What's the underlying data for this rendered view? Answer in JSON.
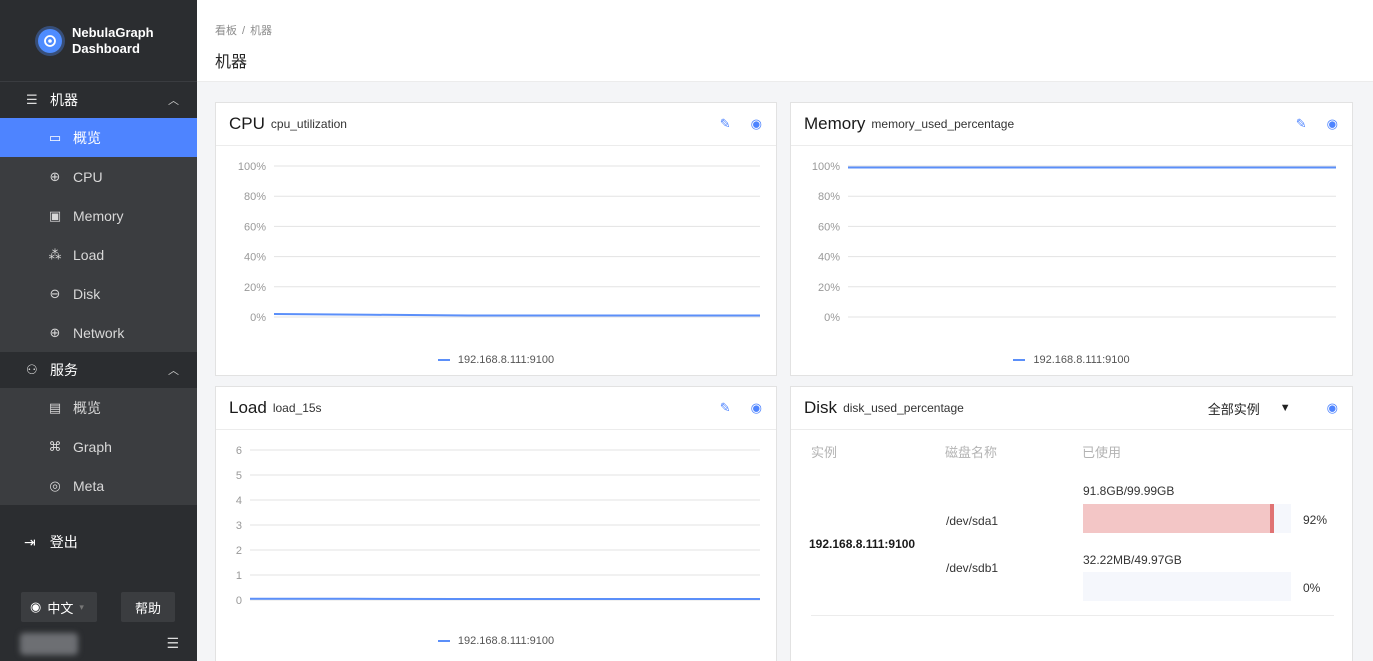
{
  "app": {
    "name_line1": "NebulaGraph",
    "name_line2": "Dashboard"
  },
  "sidebar": {
    "machine_group": "机器",
    "machine_items": [
      {
        "label": "概览",
        "icon": "area-chart-icon",
        "active": true
      },
      {
        "label": "CPU",
        "icon": "cpu-icon"
      },
      {
        "label": "Memory",
        "icon": "save-icon"
      },
      {
        "label": "Load",
        "icon": "network-nodes-icon"
      },
      {
        "label": "Disk",
        "icon": "hdd-icon"
      },
      {
        "label": "Network",
        "icon": "globe-icon"
      }
    ],
    "service_group": "服务",
    "service_items": [
      {
        "label": "概览",
        "icon": "chart-box-icon"
      },
      {
        "label": "Graph",
        "icon": "graph-icon"
      },
      {
        "label": "Meta",
        "icon": "target-icon"
      }
    ],
    "logout": "登出",
    "language": "中文",
    "help": "帮助"
  },
  "header": {
    "breadcrumb_root": "看板",
    "breadcrumb_sep": "/",
    "breadcrumb_current": "机器",
    "title": "机器"
  },
  "panels": {
    "cpu": {
      "title": "CPU",
      "metric": "cpu_utilization",
      "legend": "192.168.8.111:9100"
    },
    "memory": {
      "title": "Memory",
      "metric": "memory_used_percentage",
      "legend": "192.168.8.111:9100"
    },
    "load": {
      "title": "Load",
      "metric": "load_15s",
      "legend": "192.168.8.111:9100"
    },
    "disk": {
      "title": "Disk",
      "metric": "disk_used_percentage",
      "select": "全部实例",
      "col_instance": "实例",
      "col_disk": "磁盘名称",
      "col_used": "已使用",
      "instance": "192.168.8.111:9100",
      "rows": [
        {
          "disk": "/dev/sda1",
          "usage": "91.8GB/99.99GB",
          "percent": 92,
          "percent_label": "92%"
        },
        {
          "disk": "/dev/sdb1",
          "usage": "32.22MB/49.97GB",
          "percent": 0,
          "percent_label": "0%"
        }
      ]
    }
  },
  "chart_data": [
    {
      "type": "line",
      "id": "cpu",
      "ylim": [
        0,
        100
      ],
      "yticks": [
        "100%",
        "80%",
        "60%",
        "40%",
        "20%",
        "0%"
      ],
      "series": [
        {
          "name": "192.168.8.111:9100",
          "values": [
            2,
            1.5,
            1,
            1,
            1,
            1
          ]
        }
      ],
      "color": "#5b8ff9"
    },
    {
      "type": "line",
      "id": "memory",
      "ylim": [
        0,
        100
      ],
      "yticks": [
        "100%",
        "80%",
        "60%",
        "40%",
        "20%",
        "0%"
      ],
      "series": [
        {
          "name": "192.168.8.111:9100",
          "values": [
            99,
            99,
            99,
            99,
            99,
            99
          ]
        }
      ],
      "color": "#5b8ff9"
    },
    {
      "type": "line",
      "id": "load",
      "ylim": [
        0,
        6
      ],
      "yticks": [
        "6",
        "5",
        "4",
        "3",
        "2",
        "1",
        "0"
      ],
      "series": [
        {
          "name": "192.168.8.111:9100",
          "values": [
            0.05,
            0.05,
            0.04,
            0.04,
            0.04,
            0.04
          ]
        }
      ],
      "color": "#5b8ff9"
    }
  ]
}
